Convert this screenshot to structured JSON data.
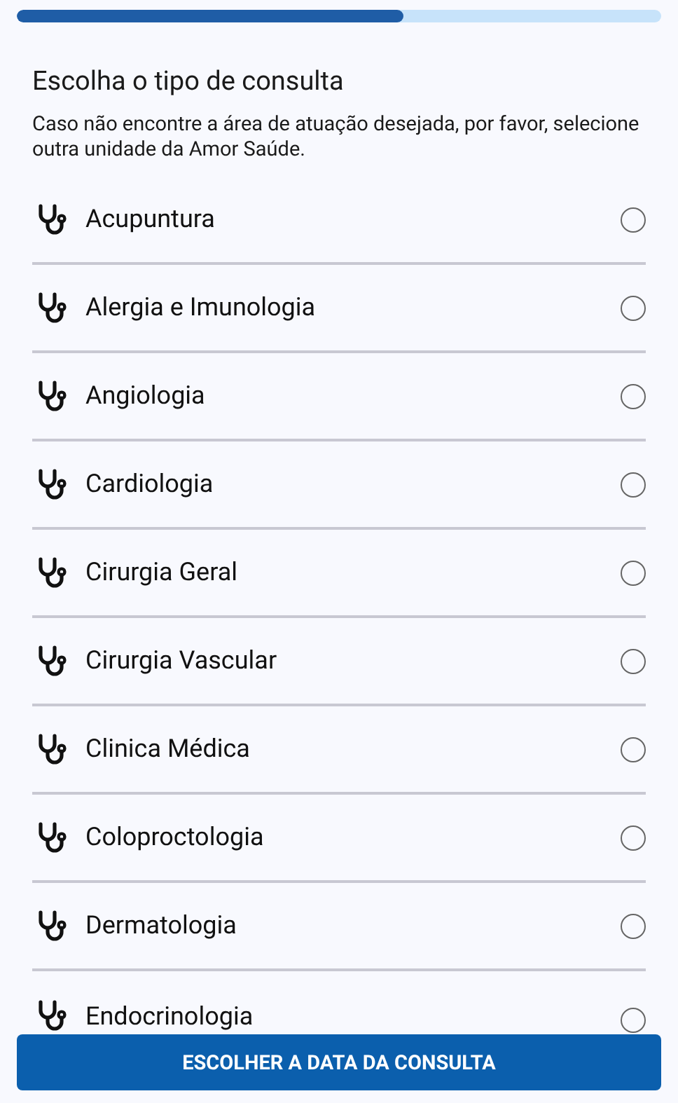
{
  "progress": {
    "level": 0.6
  },
  "title": "Escolha o tipo de consulta",
  "subtitle": "Caso não encontre a área de atuação desejada, por favor, selecione outra unidade da Amor Saúde.",
  "specialties": [
    {
      "label": "Acupuntura",
      "selected": false
    },
    {
      "label": "Alergia e Imunologia",
      "selected": false
    },
    {
      "label": "Angiologia",
      "selected": false
    },
    {
      "label": "Cardiologia",
      "selected": false
    },
    {
      "label": "Cirurgia Geral",
      "selected": false
    },
    {
      "label": "Cirurgia Vascular",
      "selected": false
    },
    {
      "label": "Clinica Médica",
      "selected": false
    },
    {
      "label": "Coloproctologia",
      "selected": false
    },
    {
      "label": "Dermatologia",
      "selected": false
    },
    {
      "label": "Endocrinologia",
      "selected": false
    }
  ],
  "button": "ESCOLHER A DATA DA CONSULTA"
}
